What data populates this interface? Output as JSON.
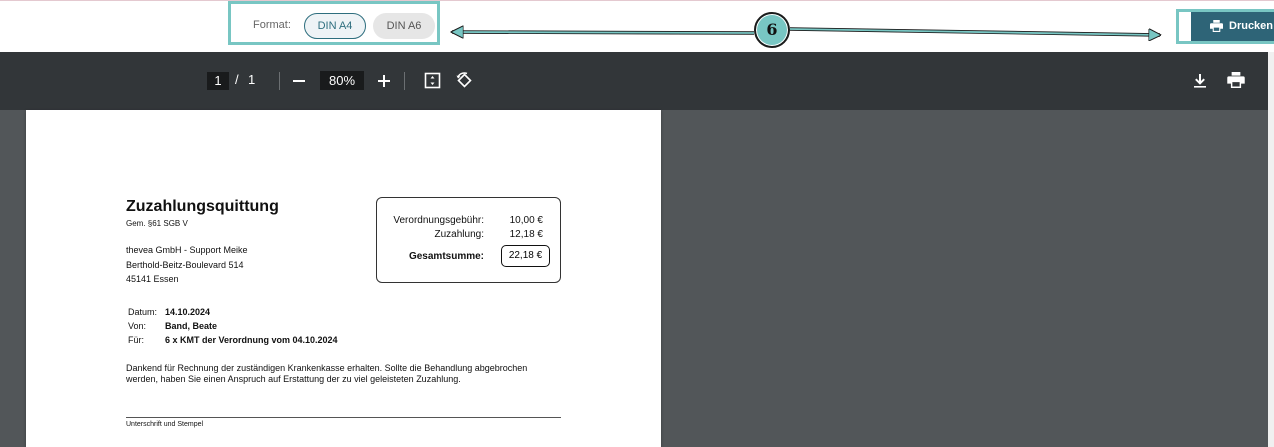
{
  "format": {
    "label": "Format:",
    "options": [
      "DIN A4",
      "DIN A6"
    ],
    "selected": "DIN A4"
  },
  "print_button": {
    "label": "Drucken"
  },
  "callout": {
    "number": "6"
  },
  "viewer": {
    "page_current": "1",
    "page_separator": "/",
    "page_total": "1",
    "zoom": "80%"
  },
  "document": {
    "title": "Zuzahlungsquittung",
    "subtitle": "Gem. §61 SGB V",
    "company": "thevea GmbH - Support Meike",
    "street": "Berthold-Beitz-Boulevard 514",
    "city": "45141 Essen",
    "summary": {
      "fee_label": "Verordnungsgebühr:",
      "fee_value": "10,00 €",
      "copay_label": "Zuzahlung:",
      "copay_value": "12,18 €",
      "total_label": "Gesamtsumme:",
      "total_value": "22,18 €"
    },
    "details": {
      "date_label": "Datum:",
      "date_value": "14.10.2024",
      "from_label": "Von:",
      "from_value": "Band, Beate",
      "for_label": "Für:",
      "for_value": "6 x KMT der Verordnung vom 04.10.2024"
    },
    "note_line1": "Dankend für Rechnung der zuständigen Krankenkasse erhalten. Sollte die Behandlung abgebrochen",
    "note_line2": "werden, haben Sie einen Anspruch auf Erstattung der zu viel geleisteten Zuzahlung.",
    "signature_label": "Unterschrift und Stempel"
  },
  "icons": {
    "zoom_out": "minus-icon",
    "zoom_in": "plus-icon",
    "fit": "fit-page-icon",
    "rotate": "rotate-icon",
    "download": "download-icon",
    "print": "printer-icon"
  },
  "colors": {
    "accent": "#78c6c3",
    "primary": "#2e6477",
    "toolbar": "#323639",
    "viewer_bg": "#525659"
  }
}
